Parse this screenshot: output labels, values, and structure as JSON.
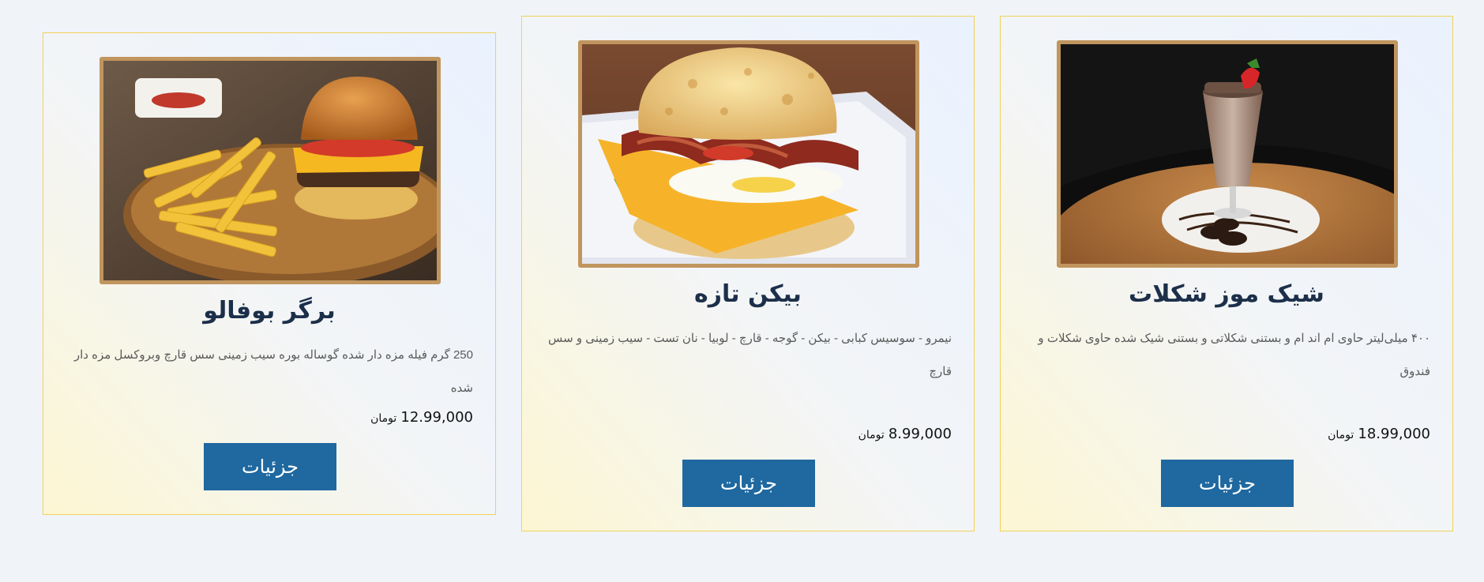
{
  "products": [
    {
      "title": "برگر بوفالو",
      "description": "250 گرم فیله مزه دار شده گوساله بوره سیب زمینی سس قارچ وبروکسل مزه دار شده",
      "price": "12.99,000",
      "currency": "تومان",
      "button_label": "جزئیات",
      "image": "burger-and-fries-photo"
    },
    {
      "title": "بیکن تازه",
      "description": "نیمرو - سوسیس کبابی - بیکن - گوجه - قارچ - لوبیا - نان تست - سیب زمینی و سس قارچ",
      "price": "8.99,000",
      "currency": "تومان",
      "button_label": "جزئیات",
      "image": "bacon-egg-biscuit-photo"
    },
    {
      "title": "شیک موز شکلات",
      "description": "۴۰۰ میلی‌لیتر حاوی ام اند ام و بستنی شکلاتی و بستنی شیک شده حاوی شکلات و فندوق",
      "price": "18.99,000",
      "currency": "تومان",
      "button_label": "جزئیات",
      "image": "chocolate-milkshake-photo"
    }
  ],
  "colors": {
    "card_border": "#f1d258",
    "frame": "#c0955e",
    "button": "#1f68a0",
    "title": "#1c2f4a"
  }
}
